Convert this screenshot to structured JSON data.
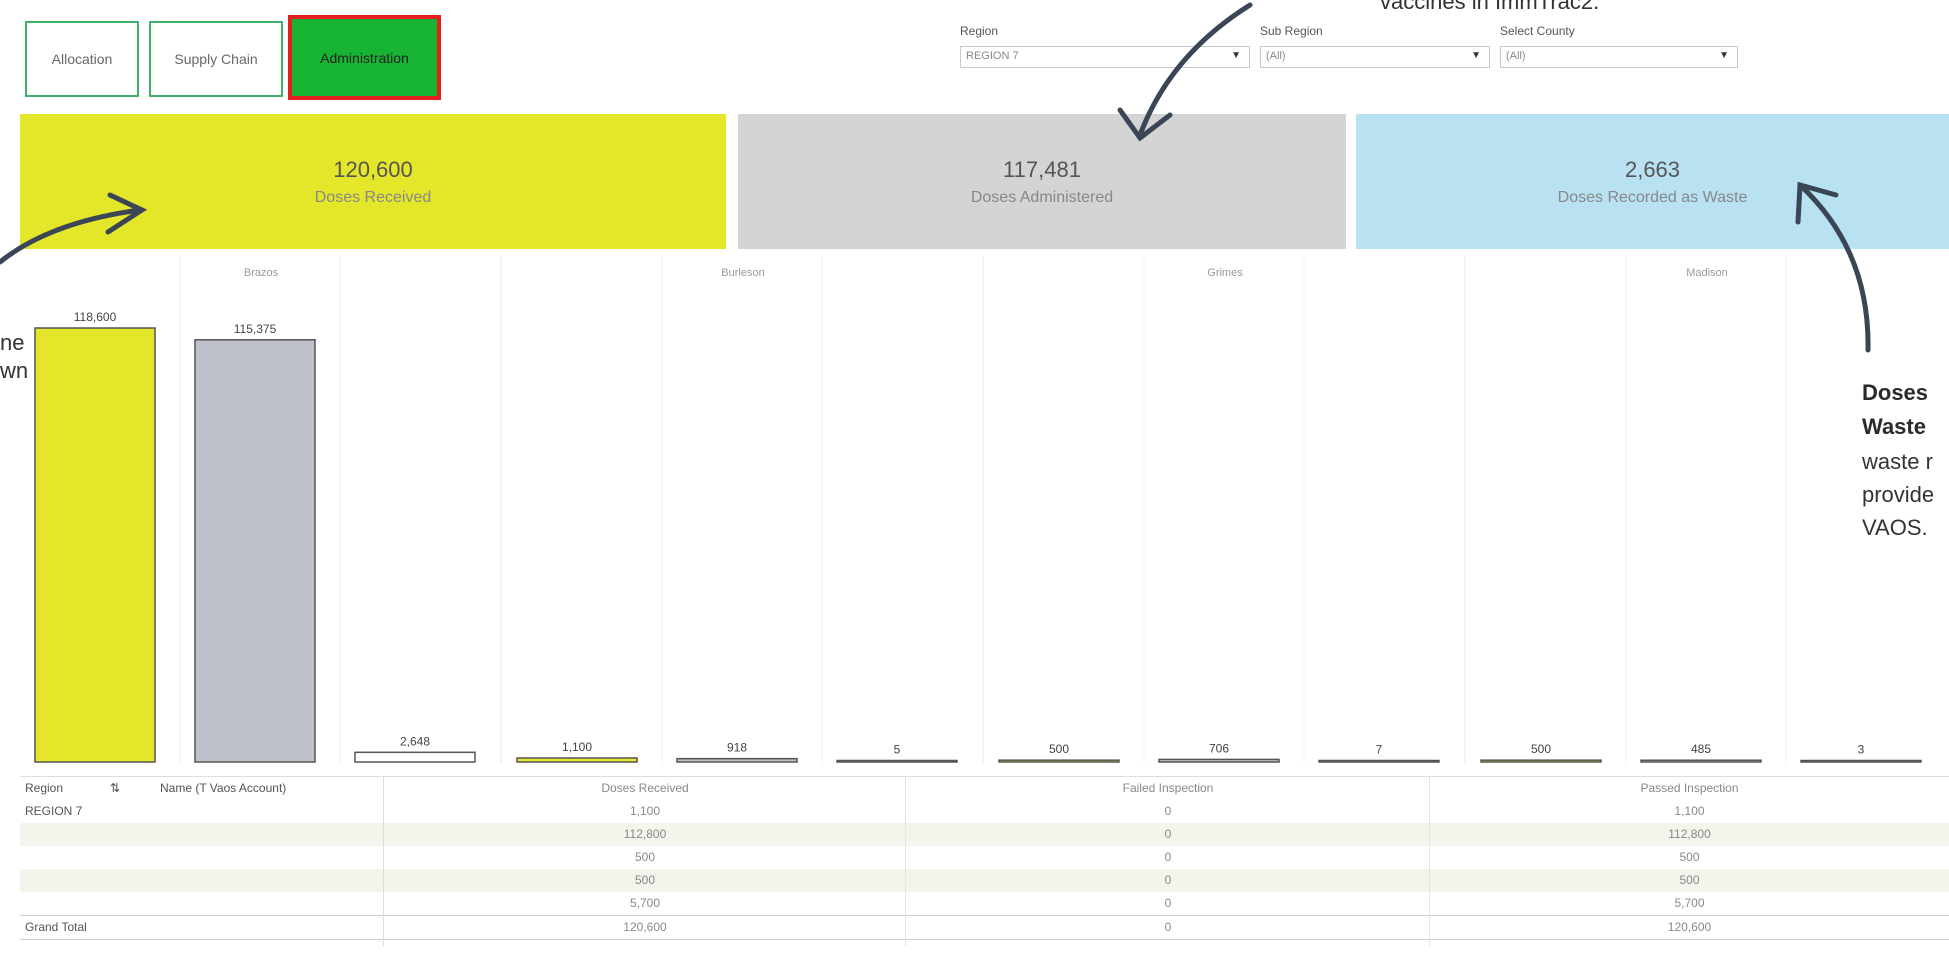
{
  "nav": {
    "allocation": "Allocation",
    "supply_chain": "Supply Chain",
    "administration": "Administration"
  },
  "filters": {
    "region": {
      "label": "Region",
      "value": "REGION 7"
    },
    "sub_region": {
      "label": "Sub Region",
      "value": "(All)"
    },
    "county": {
      "label": "Select County",
      "value": "(All)"
    }
  },
  "kpis": {
    "received": {
      "value": "120,600",
      "label": "Doses Received"
    },
    "administered": {
      "value": "117,481",
      "label": "Doses Administered"
    },
    "waste": {
      "value": "2,663",
      "label": "Doses Recorded as Waste"
    }
  },
  "colors": {
    "received": "#e4e62a",
    "administered": "#d4d4d4",
    "waste": "#b8e2f2",
    "bar_received": "#e4e62a",
    "bar_administered": "#bfc1ca",
    "nav_active": "#17b434",
    "nav_border": "#3fb069",
    "highlight": "#e41e1e"
  },
  "chart_data": {
    "type": "bar",
    "ylim": [
      0,
      118600
    ],
    "groups": [
      {
        "county": "Brazos",
        "values": [
          118600,
          115375,
          2648
        ],
        "labels": [
          "118,600",
          "115,375",
          "2,648"
        ]
      },
      {
        "county": "Burleson",
        "values": [
          1100,
          918,
          5
        ],
        "labels": [
          "1,100",
          "918",
          "5"
        ]
      },
      {
        "county": "Grimes",
        "values": [
          500,
          706,
          7
        ],
        "labels": [
          "500",
          "706",
          "7"
        ]
      },
      {
        "county": "Madison",
        "values": [
          500,
          485,
          3
        ],
        "labels": [
          "500",
          "485",
          "3"
        ]
      }
    ]
  },
  "table": {
    "headers": {
      "region": "Region",
      "name": "Name (T Vaos Account)",
      "received": "Doses Received",
      "failed": "Failed Inspection",
      "passed": "Passed Inspection"
    },
    "region_value": "REGION 7",
    "rows": [
      {
        "received": "1,100",
        "failed": "0",
        "passed": "1,100"
      },
      {
        "received": "112,800",
        "failed": "0",
        "passed": "112,800"
      },
      {
        "received": "500",
        "failed": "0",
        "passed": "500"
      },
      {
        "received": "500",
        "failed": "0",
        "passed": "500"
      },
      {
        "received": "5,700",
        "failed": "0",
        "passed": "5,700"
      }
    ],
    "total": {
      "label": "Grand Total",
      "received": "120,600",
      "failed": "0",
      "passed": "120,600"
    }
  },
  "annotations": {
    "top_fragment": "vaccines in ImmTrac2.",
    "left_line1": "ne",
    "left_line2": "wn",
    "waste_bold1": "Doses",
    "waste_bold2": "Waste",
    "waste_line3": "waste r",
    "waste_line4": "provide",
    "waste_line5": "VAOS."
  }
}
